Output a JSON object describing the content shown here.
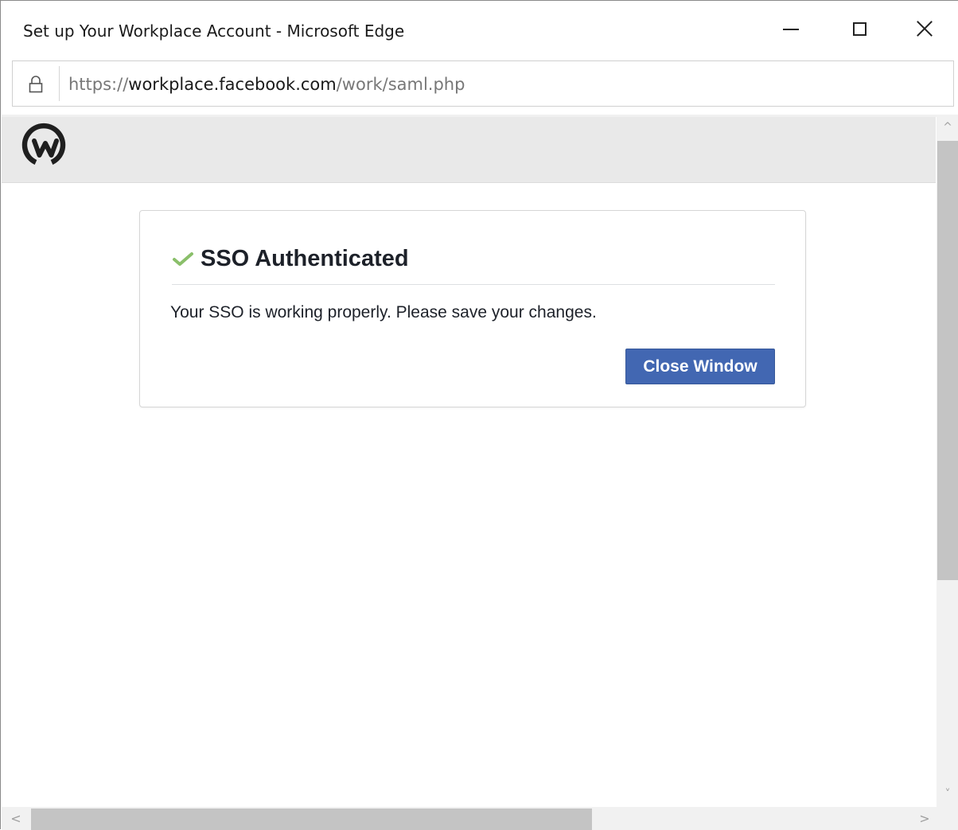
{
  "window": {
    "title": "Set up Your Workplace Account - Microsoft Edge"
  },
  "address_bar": {
    "scheme": "https://",
    "host": "workplace.facebook.com",
    "path": "/work/saml.php"
  },
  "header": {
    "logo": "workplace-logo"
  },
  "card": {
    "title": "SSO Authenticated",
    "message": "Your SSO is working properly. Please save your changes.",
    "button_label": "Close Window",
    "check_color": "#7bb661",
    "button_color": "#4267b2"
  },
  "scrollbars": {
    "up_arrow": "^",
    "down_arrow": "˅",
    "left_arrow": "<",
    "right_arrow": ">"
  }
}
